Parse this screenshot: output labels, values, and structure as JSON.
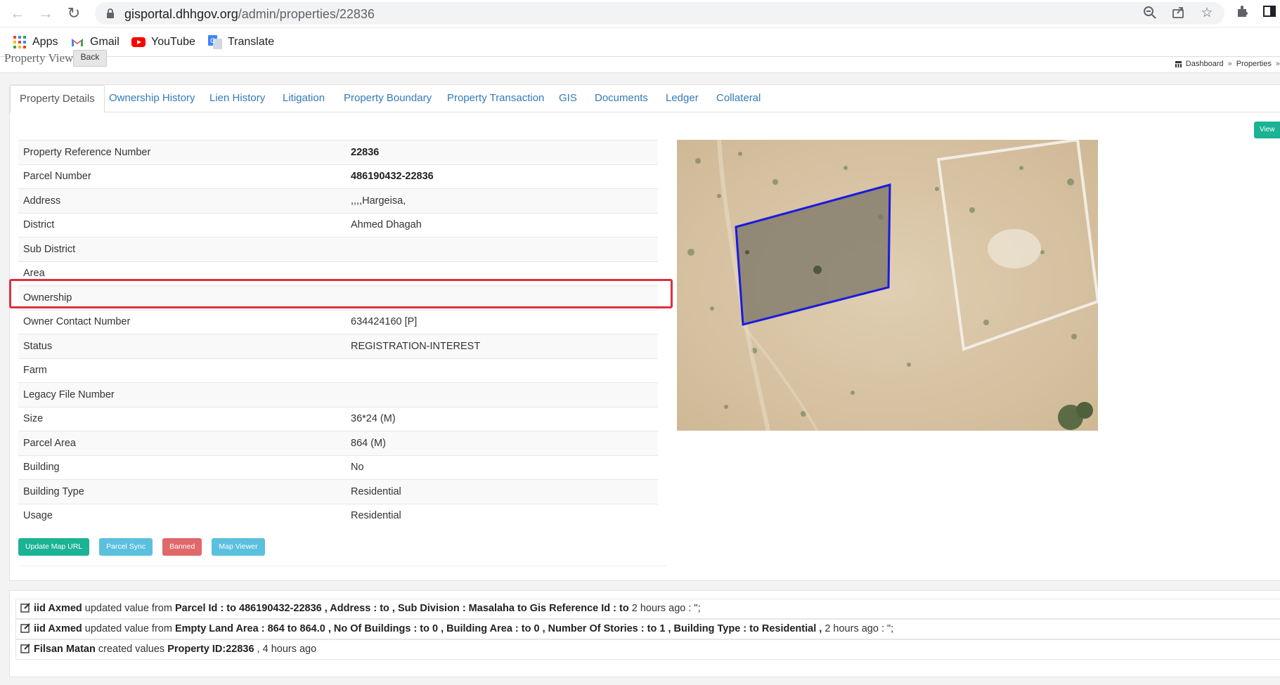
{
  "browser": {
    "url_host": "gisportal.dhhgov.org",
    "url_path": "/admin/properties/22836",
    "bookmarks": [
      {
        "label": "Apps",
        "icon": "apps-grid-icon"
      },
      {
        "label": "Gmail",
        "icon": "gmail-icon"
      },
      {
        "label": "YouTube",
        "icon": "youtube-icon"
      },
      {
        "label": "Translate",
        "icon": "translate-icon"
      }
    ]
  },
  "header": {
    "title": "Property View",
    "back_label": "Back",
    "breadcrumb": [
      "Dashboard",
      "Properties"
    ]
  },
  "tabs": [
    {
      "label": "Property Details",
      "active": true
    },
    {
      "label": "Ownership History"
    },
    {
      "label": "Lien History"
    },
    {
      "label": "Litigation"
    },
    {
      "label": "Property Boundary"
    },
    {
      "label": "Property Transaction"
    },
    {
      "label": "GIS"
    },
    {
      "label": "Documents"
    },
    {
      "label": "Ledger"
    },
    {
      "label": "Collateral"
    }
  ],
  "view_button": "View",
  "details": [
    {
      "key": "Property Reference Number",
      "value": "22836",
      "bold": true
    },
    {
      "key": "Parcel Number",
      "value": "486190432-22836",
      "bold": true
    },
    {
      "key": "Address",
      "value": ",,,,Hargeisa,"
    },
    {
      "key": "District",
      "value": "Ahmed Dhagah"
    },
    {
      "key": "Sub District",
      "value": ""
    },
    {
      "key": "Area",
      "value": ""
    },
    {
      "key": "Ownership",
      "value": ""
    },
    {
      "key": "Owner Contact Number",
      "value": "634424160 [P]"
    },
    {
      "key": "Status",
      "value": "REGISTRATION-INTEREST"
    },
    {
      "key": "Farm",
      "value": ""
    },
    {
      "key": "Legacy File Number",
      "value": ""
    },
    {
      "key": "Size",
      "value": "36*24 (M)"
    },
    {
      "key": "Parcel Area",
      "value": "864 (M)"
    },
    {
      "key": "Building",
      "value": "No"
    },
    {
      "key": "Building Type",
      "value": "Residential"
    },
    {
      "key": "Usage",
      "value": "Residential"
    }
  ],
  "actions": {
    "update_map_url": "Update Map URL",
    "parcel_sync": "Parcel Sync",
    "banned": "Banned",
    "map_viewer": "Map Viewer"
  },
  "colors": {
    "primary_green": "#1ab394",
    "info_blue": "#5bc0de",
    "danger_red": "#e0676a",
    "highlight_red": "#d9333f",
    "parcel_outline": "#1a1adf",
    "link_blue": "#337ab7"
  },
  "activity_log": [
    {
      "user": "iid Axmed",
      "action": "updated value from",
      "detail": "Parcel Id : to 486190432-22836 , Address : to , Sub Division : Masalaha to Gis Reference Id : to",
      "time": "2 hours ago : \";"
    },
    {
      "user": "iid Axmed",
      "action": "updated value from",
      "detail": "Empty Land Area : 864 to 864.0 , No Of Buildings : to 0 , Building Area : to 0 , Number Of Stories : to 1 , Building Type : to Residential ,",
      "time": "2 hours ago : \";"
    },
    {
      "user": "Filsan Matan",
      "action": "created values",
      "detail": "Property ID:22836",
      "time": ", 4 hours ago"
    }
  ]
}
